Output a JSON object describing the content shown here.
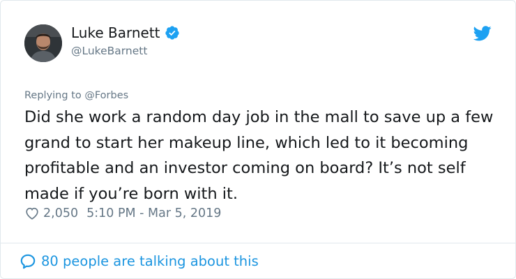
{
  "tweet": {
    "author": {
      "name": "Luke Barnett",
      "handle": "@LukeBarnett",
      "verified": true,
      "avatar_icon": "profile-photo"
    },
    "brand_icon": "twitter-bird-icon",
    "brand_color": "#1da1f2",
    "replying_prefix": "Replying to",
    "replying_to": "@Forbes",
    "text": "Did she work a random day job in the mall to save up a few grand to start her makeup line, which led to it becoming profitable and an investor coming on board? It’s not self made if you’re born with it.",
    "likes": "2,050",
    "timestamp": "5:10 PM - Mar 5, 2019",
    "talking_about": "80 people are talking about this",
    "colors": {
      "text": "#14171a",
      "secondary": "#657786",
      "link": "#1b95e0",
      "border": "#e1e8ed"
    }
  }
}
